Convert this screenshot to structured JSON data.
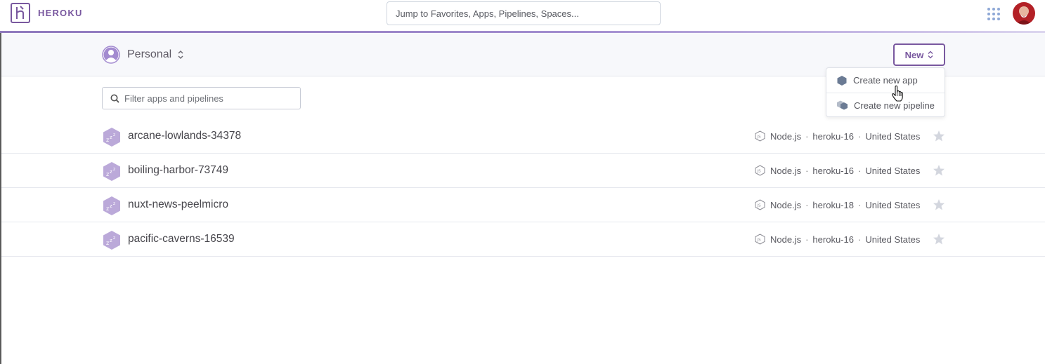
{
  "brand": {
    "name": "HEROKU",
    "accent": "#79589f"
  },
  "search": {
    "placeholder": "Jump to Favorites, Apps, Pipelines, Spaces..."
  },
  "account": {
    "label": "Personal"
  },
  "new_button": {
    "label": "New"
  },
  "new_menu": {
    "items": [
      {
        "label": "Create new app",
        "icon": "app-hexagon-icon"
      },
      {
        "label": "Create new pipeline",
        "icon": "pipeline-icon"
      }
    ]
  },
  "filter": {
    "placeholder": "Filter apps and pipelines"
  },
  "apps": [
    {
      "name": "arcane-lowlands-34378",
      "language": "Node.js",
      "stack": "heroku-16",
      "region": "United States"
    },
    {
      "name": "boiling-harbor-73749",
      "language": "Node.js",
      "stack": "heroku-16",
      "region": "United States"
    },
    {
      "name": "nuxt-news-peelmicro",
      "language": "Node.js",
      "stack": "heroku-18",
      "region": "United States"
    },
    {
      "name": "pacific-caverns-16539",
      "language": "Node.js",
      "stack": "heroku-16",
      "region": "United States"
    }
  ],
  "separator": "·"
}
